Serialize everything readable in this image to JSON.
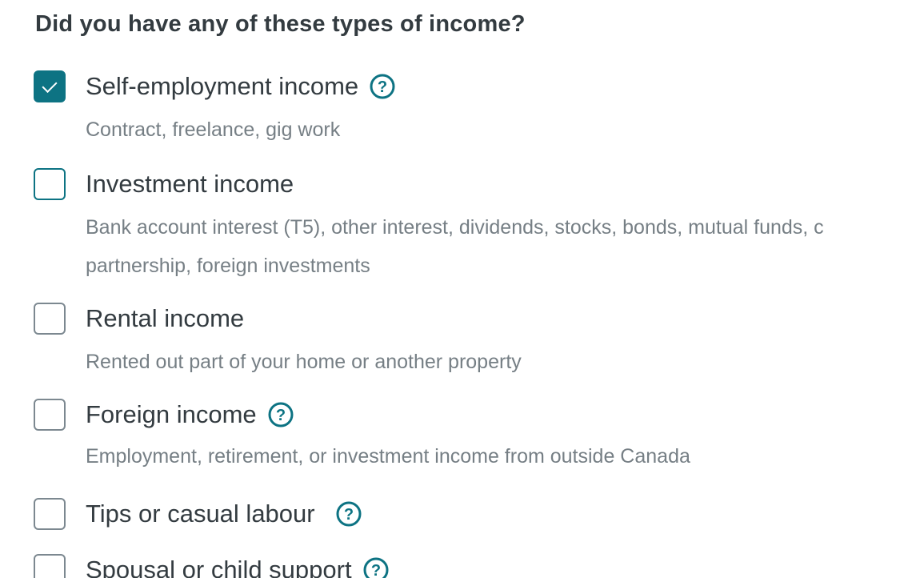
{
  "question": "Did you have any of these types of income?",
  "colors": {
    "accent": "#0d7383",
    "text": "#333b40",
    "muted": "#767f85",
    "border": "#7c8890"
  },
  "options": [
    {
      "label": "Self-employment income",
      "description_lines": [
        "Contract, freelance, gig work"
      ],
      "checked": true,
      "help_icon": "question-circle-icon"
    },
    {
      "label": "Investment income",
      "description_lines": [
        "Bank account interest (T5), other interest, dividends, stocks, bonds, mutual funds, c",
        "partnership, foreign investments"
      ],
      "checked": false,
      "help_icon": null
    },
    {
      "label": "Rental income",
      "description_lines": [
        "Rented out part of your home or another property"
      ],
      "checked": false,
      "help_icon": null
    },
    {
      "label": "Foreign income",
      "description_lines": [
        "Employment, retirement, or investment income from outside Canada"
      ],
      "checked": false,
      "help_icon": "question-circle-icon"
    },
    {
      "label": "Tips or casual labour",
      "description_lines": [],
      "checked": false,
      "help_icon": "question-circle-icon"
    },
    {
      "label": "Spousal or child support",
      "description_lines": [],
      "checked": false,
      "help_icon": "question-circle-icon"
    }
  ]
}
